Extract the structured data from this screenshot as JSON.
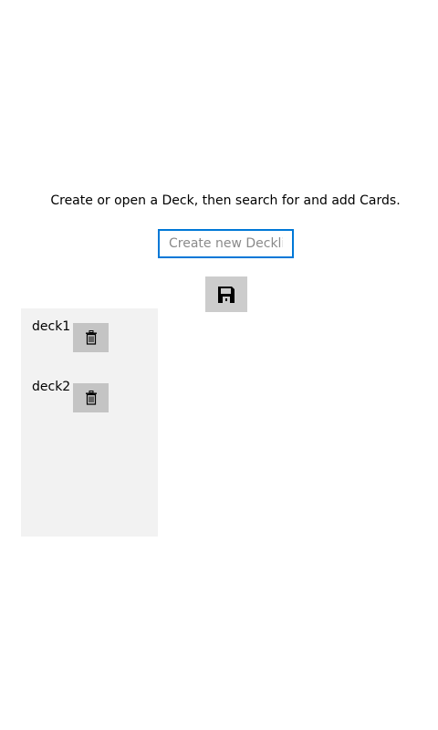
{
  "main": {
    "instructions": "Create or open a Deck, then search for and add Cards.",
    "new_deck_input": {
      "value": "",
      "placeholder": "Create new Decklist"
    },
    "save_button_icon": "save-icon"
  },
  "decks": [
    {
      "name": "deck1",
      "delete_icon": "trash-icon"
    },
    {
      "name": "deck2",
      "delete_icon": "trash-icon"
    }
  ],
  "colors": {
    "accent": "#0078d7",
    "button_background": "#cccccc",
    "panel_background": "#f2f2f2"
  }
}
